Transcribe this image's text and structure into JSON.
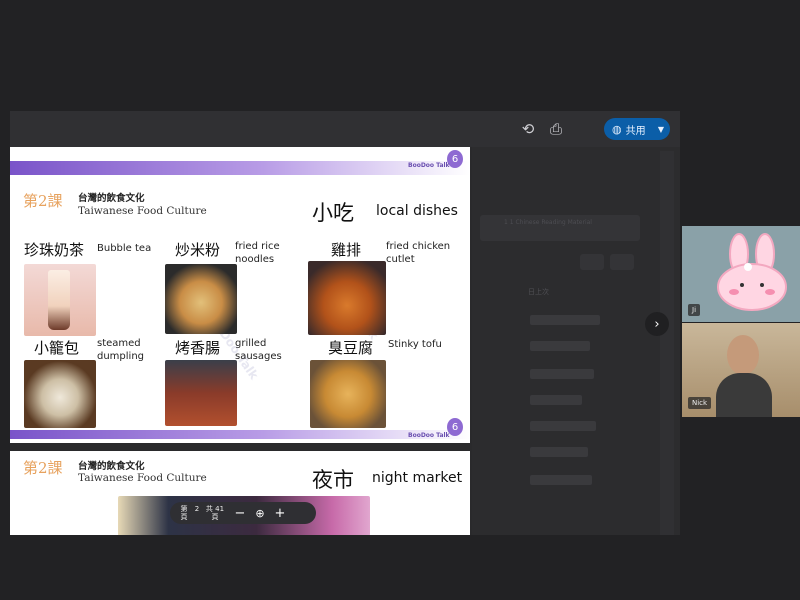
{
  "share_toolbar": {
    "share_button_label": "共用",
    "icons": [
      "add-to-drive-icon",
      "print-icon",
      "globe-icon",
      "dropdown-caret-icon"
    ]
  },
  "background_app": {
    "header": "1 1 Chinese Reading Material",
    "column_label": "日上次"
  },
  "slide1": {
    "lesson": "第2課",
    "title_zh": "台灣的飲食文化",
    "title_en": "Taiwanese Food Culture",
    "heading_zh": "小吃",
    "heading_en": "local dishes",
    "logo_text": "BooDoo Talk",
    "watermark": "BooDoo Talk",
    "items": [
      {
        "zh": "珍珠奶茶",
        "en": "Bubble tea"
      },
      {
        "zh": "炒米粉",
        "en": "fried rice noodles"
      },
      {
        "zh": "雞排",
        "en": "fried chicken cutlet"
      },
      {
        "zh": "小籠包",
        "en": "steamed dumpling"
      },
      {
        "zh": "烤香腸",
        "en": "grilled sausages"
      },
      {
        "zh": "臭豆腐",
        "en": "Stinky tofu"
      }
    ]
  },
  "slide2": {
    "lesson": "第2課",
    "title_zh": "台灣的飲食文化",
    "title_en": "Taiwanese Food Culture",
    "heading_zh": "夜市",
    "heading_en": "night market"
  },
  "pdf_nav": {
    "page_label_top": "第",
    "page_label_bottom": "頁",
    "page": "2",
    "total_label_top": "共 41",
    "total_label_bottom": "頁",
    "zoom_out": "−",
    "zoom_in": "+"
  },
  "participants": [
    {
      "name": "Ji"
    },
    {
      "name": "Nick"
    }
  ]
}
